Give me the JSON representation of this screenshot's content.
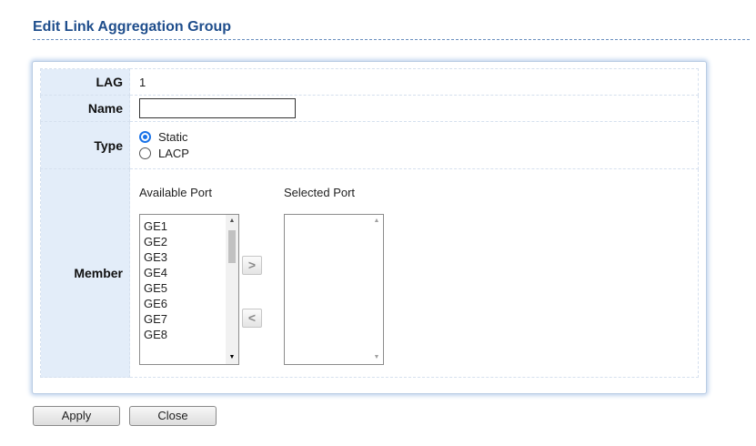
{
  "page": {
    "title": "Edit Link Aggregation Group"
  },
  "form": {
    "lag": {
      "label": "LAG",
      "value": "1"
    },
    "name": {
      "label": "Name",
      "value": "",
      "placeholder": ""
    },
    "type": {
      "label": "Type",
      "options": [
        {
          "label": "Static",
          "selected": true
        },
        {
          "label": "LACP",
          "selected": false
        }
      ]
    },
    "member": {
      "label": "Member",
      "available_heading": "Available Port",
      "selected_heading": "Selected Port",
      "available_ports": [
        "GE1",
        "GE2",
        "GE3",
        "GE4",
        "GE5",
        "GE6",
        "GE7",
        "GE8"
      ],
      "selected_ports": [],
      "add_icon": ">",
      "remove_icon": "<"
    }
  },
  "buttons": {
    "apply": "Apply",
    "close": "Close"
  },
  "colors": {
    "title": "#1f4e8c",
    "label_bg": "#e3edf9",
    "radio_accent": "#1a73e8",
    "panel_border": "#b9cce3"
  }
}
